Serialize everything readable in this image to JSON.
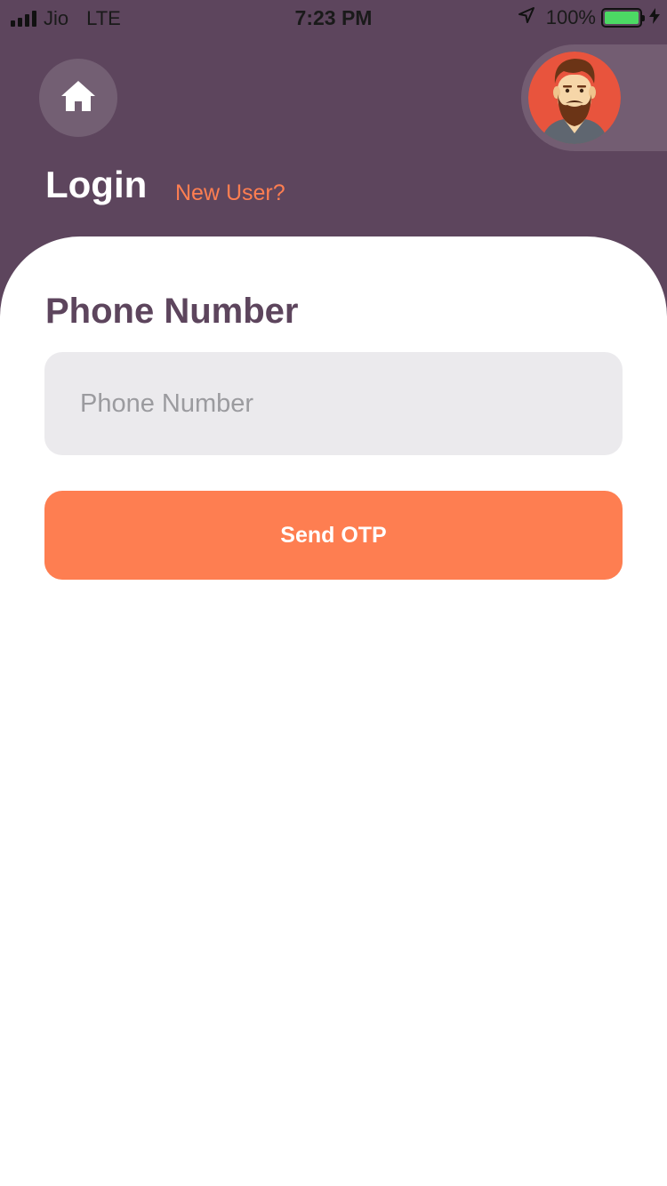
{
  "status_bar": {
    "carrier": "Jio",
    "network": "LTE",
    "time": "7:23 PM",
    "battery_percent": "100%",
    "battery_level": 1.0,
    "icons": [
      "signal-bars-icon",
      "location-arrow-icon",
      "battery-icon",
      "charging-bolt-icon"
    ]
  },
  "header": {
    "home_icon": "home-icon",
    "avatar_icon": "bearded-man-avatar",
    "title": "Login",
    "new_user_link": "New User?"
  },
  "form": {
    "phone_label": "Phone Number",
    "phone_value": "",
    "phone_placeholder": "Phone Number",
    "send_otp_label": "Send OTP"
  },
  "colors": {
    "header_background": "#5d455d",
    "accent": "#fe7e51",
    "input_background": "#ebeaed",
    "label_text": "#5d455d",
    "card_background": "#ffffff",
    "battery_fill": "#4cd964"
  }
}
